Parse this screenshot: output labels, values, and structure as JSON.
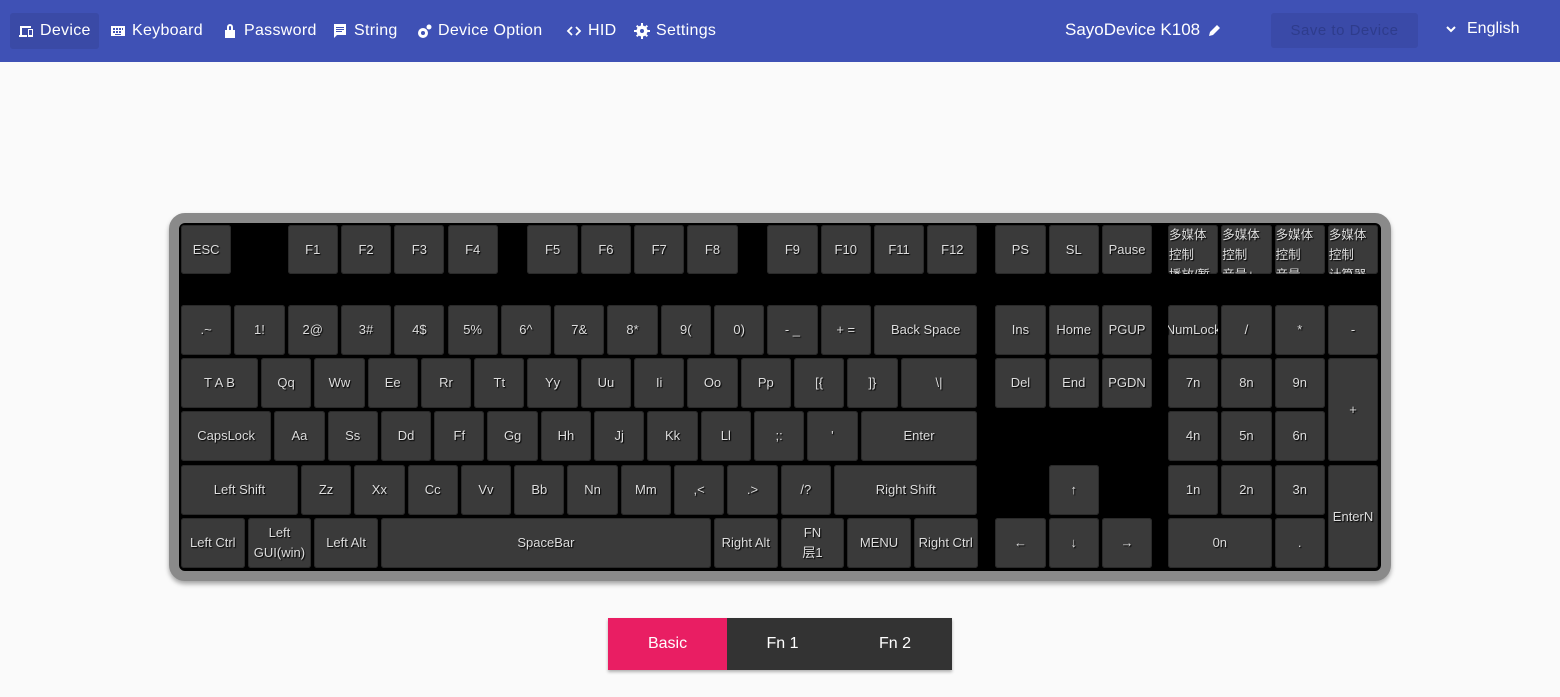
{
  "topbar": {
    "nav": [
      {
        "label": "Device",
        "icon": "devices-icon",
        "active": true
      },
      {
        "label": "Keyboard",
        "icon": "keyboard-icon"
      },
      {
        "label": "Password",
        "icon": "lock-icon"
      },
      {
        "label": "String",
        "icon": "message-icon"
      },
      {
        "label": "Device Option",
        "icon": "gears-icon"
      },
      {
        "label": "HID",
        "icon": "code-icon"
      },
      {
        "label": "Settings",
        "icon": "gear-icon"
      }
    ],
    "device_name": "SayoDevice K108",
    "save_label": "Save to Device",
    "language": "English"
  },
  "keyboard": {
    "keys": [
      "ESC",
      "F1",
      "F2",
      "F3",
      "F4",
      "F5",
      "F6",
      "F7",
      "F8",
      "F9",
      "F10",
      "F11",
      "F12",
      "PS",
      "SL",
      "Pause",
      "多媒体控制\n播放/暂停",
      "多媒体控制\n音量+",
      "多媒体控制\n音量-",
      "多媒体控制\n计算器",
      ".~",
      "1!",
      "2@",
      "3#",
      "4$",
      "5%",
      "6^",
      "7&",
      "8*",
      "9(",
      "0)",
      "- _",
      "+ =",
      "Back Space",
      "Ins",
      "Home",
      "PGUP",
      "NumLock",
      "/",
      "*",
      "-",
      "T A B",
      "Qq",
      "Ww",
      "Ee",
      "Rr",
      "Tt",
      "Yy",
      "Uu",
      "Ii",
      "Oo",
      "Pp",
      "[{",
      "]}",
      "\\|",
      "Del",
      "End",
      "PGDN",
      "7n",
      "8n",
      "9n",
      "+",
      "CapsLock",
      "Aa",
      "Ss",
      "Dd",
      "Ff",
      "Gg",
      "Hh",
      "Jj",
      "Kk",
      "Ll",
      ";:",
      "'",
      "Enter",
      "4n",
      "5n",
      "6n",
      "Left Shift",
      "Zz",
      "Xx",
      "Cc",
      "Vv",
      "Bb",
      "Nn",
      "Mm",
      ",<",
      ".>",
      "/?",
      "Right Shift",
      "↑",
      "1n",
      "2n",
      "3n",
      "EnterN",
      "Left Ctrl",
      "Left\nGUI(win)",
      "Left Alt",
      "SpaceBar",
      "Right Alt",
      "FN\n层1",
      "MENU",
      "Right Ctrl",
      "←",
      "↓",
      "→",
      "0n",
      "."
    ]
  },
  "layers": {
    "tabs": [
      {
        "label": "Basic",
        "active": true
      },
      {
        "label": "Fn 1"
      },
      {
        "label": "Fn 2"
      }
    ]
  },
  "colors": {
    "header": "#3f51b5",
    "active_tab": "#e91e63",
    "tab": "#333333",
    "key": "#3a3a3a"
  }
}
